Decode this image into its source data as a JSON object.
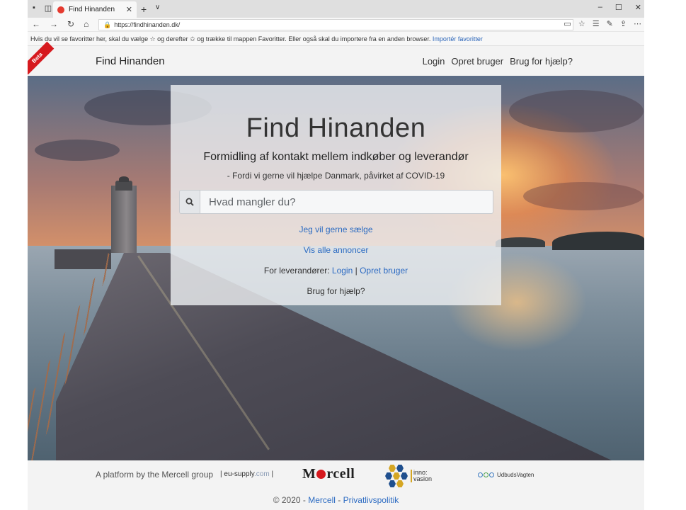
{
  "browser": {
    "tab_title": "Find Hinanden",
    "tab_close": "✕",
    "new_tab": "+",
    "tab_list": "∨",
    "url": "https://findhinanden.dk/",
    "favorites_text": "Hvis du vil se favoritter her, skal du vælge ☆ og derefter ✩ og trække til mappen Favoritter. Eller også skal du importere fra en anden browser.",
    "favorites_link": "Importér favoritter",
    "window_controls": {
      "minimize": "–",
      "maximize": "☐",
      "close": "✕"
    }
  },
  "navbar": {
    "badge": "Beta",
    "brand": "Find Hinanden",
    "links": [
      "Login",
      "Opret bruger",
      "Brug for hjælp?"
    ]
  },
  "hero": {
    "title": "Find Hinanden",
    "subtitle": "Formidling af kontakt mellem indkøber og leverandør",
    "tagline": "- Fordi vi gerne vil hjælpe Danmark, påvirket af COVID-19",
    "search_placeholder": "Hvad mangler du?",
    "sell_link": "Jeg vil gerne sælge",
    "all_ads_link": "Vis alle annoncer",
    "supplier_prefix": "For leverandører:",
    "supplier_login": "Login",
    "separator": "|",
    "supplier_register": "Opret bruger",
    "help": "Brug for hjælp?"
  },
  "footer": {
    "platform_text": "A platform by the Mercell group",
    "eu_supply_main": "eu-supply",
    "eu_supply_ext": ".com",
    "pipe": "|",
    "mercell_logo_start": "M",
    "mercell_logo_end": "rcell",
    "innovasion_line1": "inno:",
    "innovasion_line2": "vasion",
    "udbudsvagten": "UdbudsVagten",
    "copyright": "© 2020 -",
    "copyright_link": "Mercell",
    "dash": "-",
    "privacy": "Privatlivspolitik"
  },
  "colors": {
    "link": "#2c6bc2",
    "beta": "#d6191e",
    "card_bg": "#eef0f3"
  }
}
